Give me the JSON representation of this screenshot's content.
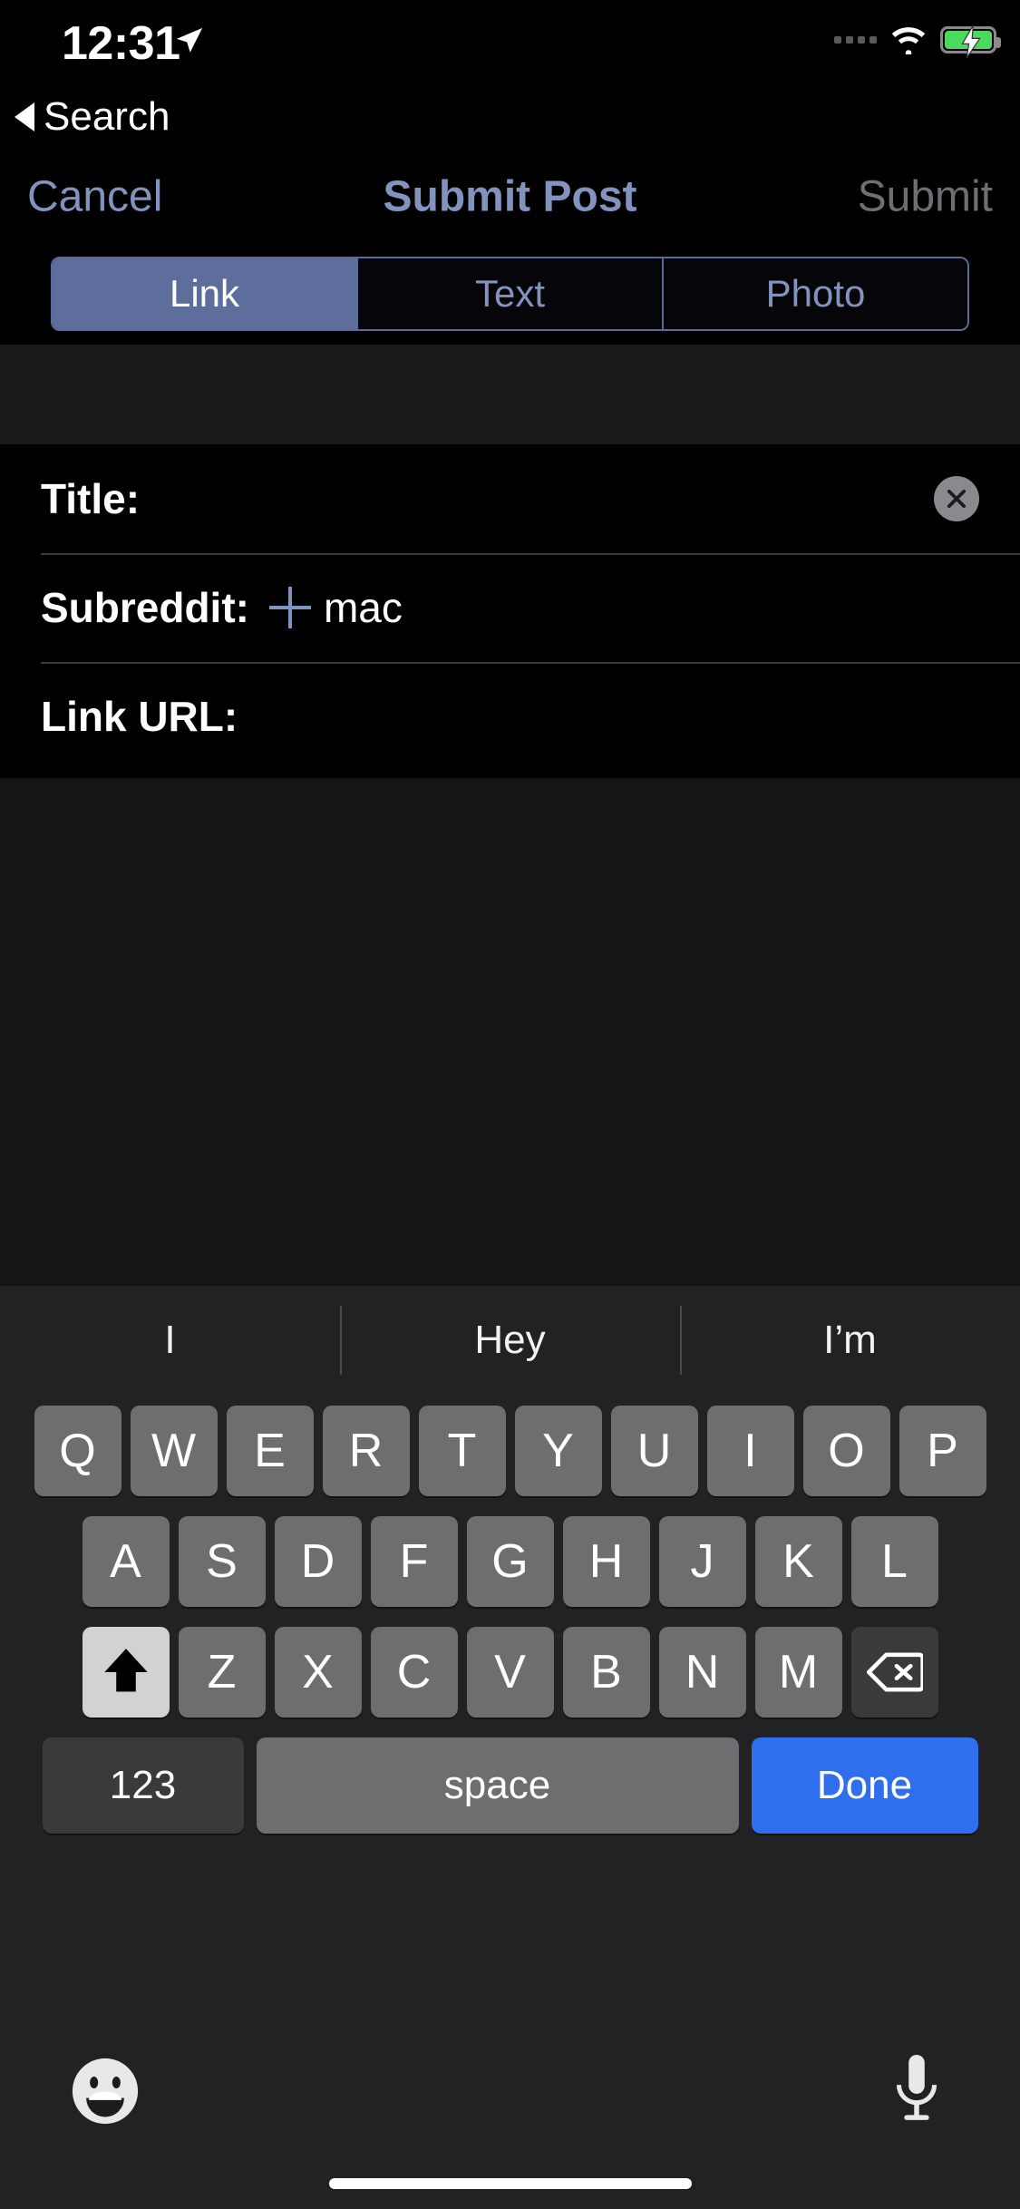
{
  "status_bar": {
    "time": "12:31",
    "location_icon": "location-arrow-icon",
    "cellular_icon": "cellular-dots-icon",
    "wifi_icon": "wifi-icon",
    "battery_icon": "battery-charging-icon",
    "battery_charging": true
  },
  "back_link": {
    "label": "Search",
    "caret_icon": "back-caret-icon"
  },
  "navbar": {
    "cancel_label": "Cancel",
    "title": "Submit Post",
    "submit_label": "Submit"
  },
  "segmented_control": {
    "options": [
      {
        "label": "Link",
        "selected": true
      },
      {
        "label": "Text",
        "selected": false
      },
      {
        "label": "Photo",
        "selected": false
      }
    ]
  },
  "form": {
    "fields": [
      {
        "label": "Title:",
        "value": "",
        "placeholder": ""
      },
      {
        "label": "Subreddit:",
        "value": "mac",
        "placeholder": ""
      },
      {
        "label": "Link URL:",
        "value": "",
        "placeholder": ""
      }
    ],
    "clear_icon": "clear-circle-icon",
    "plus_icon": "plus-icon"
  },
  "keyboard": {
    "predictions": [
      "I",
      "Hey",
      "I’m"
    ],
    "row1": [
      "Q",
      "W",
      "E",
      "R",
      "T",
      "Y",
      "U",
      "I",
      "O",
      "P"
    ],
    "row2": [
      "A",
      "S",
      "D",
      "F",
      "G",
      "H",
      "J",
      "K",
      "L"
    ],
    "row3": [
      "Z",
      "X",
      "C",
      "V",
      "B",
      "N",
      "M"
    ],
    "shift_icon": "shift-arrow-icon",
    "delete_icon": "backspace-icon",
    "numeric_label": "123",
    "space_label": "space",
    "done_label": "Done",
    "emoji_icon": "emoji-smiley-icon",
    "mic_icon": "microphone-icon",
    "shift_active": true
  },
  "colors": {
    "accent_blue": "#8294bd",
    "segment_selected": "#5d6d9c",
    "done_blue": "#2f6fed",
    "battery_green": "#4cd95f",
    "key_gray": "#6e6e70",
    "shift_light": "#d2d2d4"
  }
}
